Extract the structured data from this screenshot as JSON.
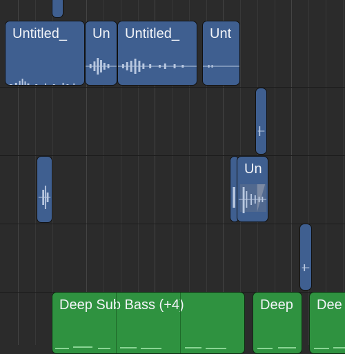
{
  "regions": {
    "untitled_1": {
      "label": "Untitled_"
    },
    "untitled_2": {
      "label": "Un"
    },
    "untitled_3": {
      "label": "Untitled_"
    },
    "untitled_4": {
      "label": "Unt"
    },
    "untitled_5": {
      "label": "Un"
    },
    "deep_sub_bass": {
      "label": "Deep Sub Bass (+4)"
    },
    "deep_2": {
      "label": "Deep"
    },
    "deep_3": {
      "label": "Dee"
    }
  },
  "colors": {
    "audio_region": "#3f5f90",
    "midi_region": "#2f9240",
    "background": "#2b2b2b"
  }
}
